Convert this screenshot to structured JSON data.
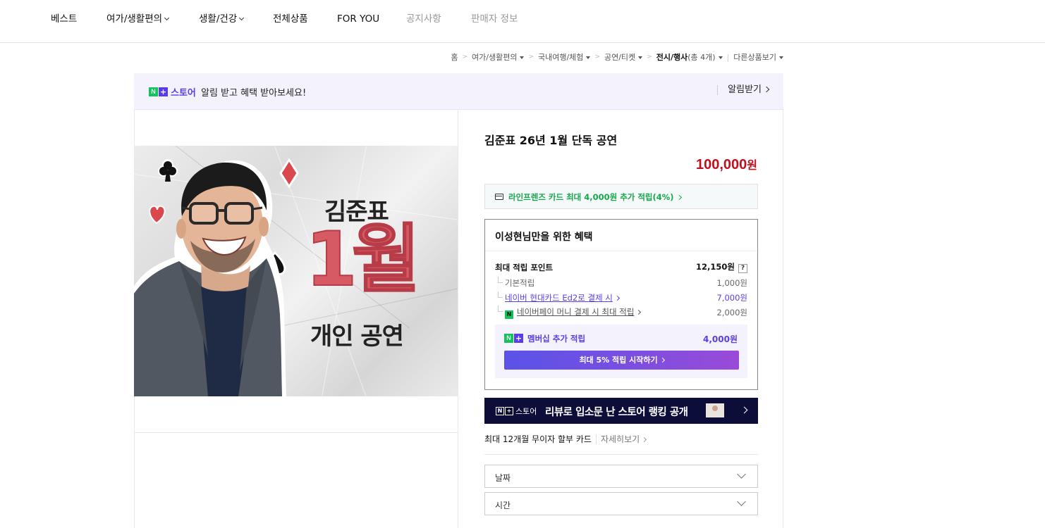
{
  "topnav": {
    "items": [
      {
        "label": "베스트",
        "dropdown": false,
        "muted": false
      },
      {
        "label": "여가/생활편의",
        "dropdown": true,
        "muted": false
      },
      {
        "label": "생활/건강",
        "dropdown": true,
        "muted": false
      },
      {
        "label": "전체상품",
        "dropdown": false,
        "muted": false
      },
      {
        "label": "FOR YOU",
        "dropdown": false,
        "muted": false
      },
      {
        "label": "공지사항",
        "dropdown": false,
        "muted": true
      },
      {
        "label": "판매자 정보",
        "dropdown": false,
        "muted": true
      }
    ]
  },
  "breadcrumb": {
    "home": "홈",
    "level1": "여가/생활편의",
    "level2": "국내여행/체험",
    "level3": "공연/티켓",
    "current": "전시/행사",
    "current_count": "(총 4개)",
    "other": "다른상품보기"
  },
  "notify": {
    "brand_n": "N",
    "brand_plus": "+",
    "brand_text": "스토어",
    "message": "알림 받고 혜택 받아보세요!",
    "button": "알림받기"
  },
  "poster": {
    "line1": "김준표",
    "line2": "1월",
    "line3": "개인 공연"
  },
  "product": {
    "title": "김준표 26년 1월 단독 공연",
    "price": "100,000",
    "currency": "원"
  },
  "card_promo": {
    "text": "라인프렌즈 카드 최대 4,000원 추가 적립(4%)"
  },
  "benefit": {
    "heading": "이성현님만을 위한 혜택",
    "max_points_label": "최대 적립 포인트",
    "max_points_value": "12,150원",
    "help": "?",
    "rows": [
      {
        "label": "기본적립",
        "value": "1,000원"
      },
      {
        "label": "네이버 현대카드 Ed2로 결제 시",
        "value": "7,000원"
      },
      {
        "label": "네이버페이 머니 결제 시 최대 적립",
        "value": "2,000원"
      }
    ],
    "npay_badge": "N",
    "membership_label": "멤버십 추가 적립",
    "membership_value": "4,000원",
    "cta": "최대 5% 적립 시작하기"
  },
  "banner": {
    "logo_n": "N",
    "logo_plus": "+",
    "logo_text": "스토어",
    "text": "리뷰로 입소문 난 스토어 랭킹 공개"
  },
  "installment": {
    "text": "최대 12개월 무이자 할부 카드",
    "more": "자세히보기"
  },
  "options": {
    "date_placeholder": "날짜",
    "time_placeholder": "시간"
  },
  "colors": {
    "price": "#c0101f",
    "brand_green": "#10c35a",
    "brand_purple": "#5b3ce8",
    "promo_green": "#14a84b",
    "banner_bg": "#0d0d3a"
  }
}
